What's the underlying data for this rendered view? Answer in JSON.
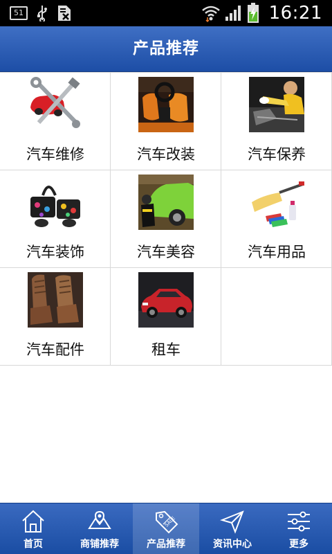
{
  "status_bar": {
    "notification_count": "51",
    "time": "16:21"
  },
  "header": {
    "title": "产品推荐"
  },
  "categories": [
    {
      "label": "汽车维修",
      "icon": "repair-tools-icon"
    },
    {
      "label": "汽车改装",
      "icon": "car-interior-icon"
    },
    {
      "label": "汽车保养",
      "icon": "mechanic-icon"
    },
    {
      "label": "汽车装饰",
      "icon": "decor-accessories-icon"
    },
    {
      "label": "汽车美容",
      "icon": "car-wash-icon"
    },
    {
      "label": "汽车用品",
      "icon": "cleaning-brush-icon"
    },
    {
      "label": "汽车配件",
      "icon": "car-seat-icon"
    },
    {
      "label": "租车",
      "icon": "red-suv-icon"
    }
  ],
  "bottom_nav": [
    {
      "label": "首页",
      "icon": "home-icon"
    },
    {
      "label": "商铺推荐",
      "icon": "shop-map-icon"
    },
    {
      "label": "产品推荐",
      "icon": "sale-tag-icon",
      "active": true
    },
    {
      "label": "资讯中心",
      "icon": "send-icon"
    },
    {
      "label": "更多",
      "icon": "sliders-icon"
    }
  ],
  "colors": {
    "header_blue": "#2a5cb5",
    "nav_blue": "#1f51a8",
    "grid_border": "#d8d8d8"
  }
}
